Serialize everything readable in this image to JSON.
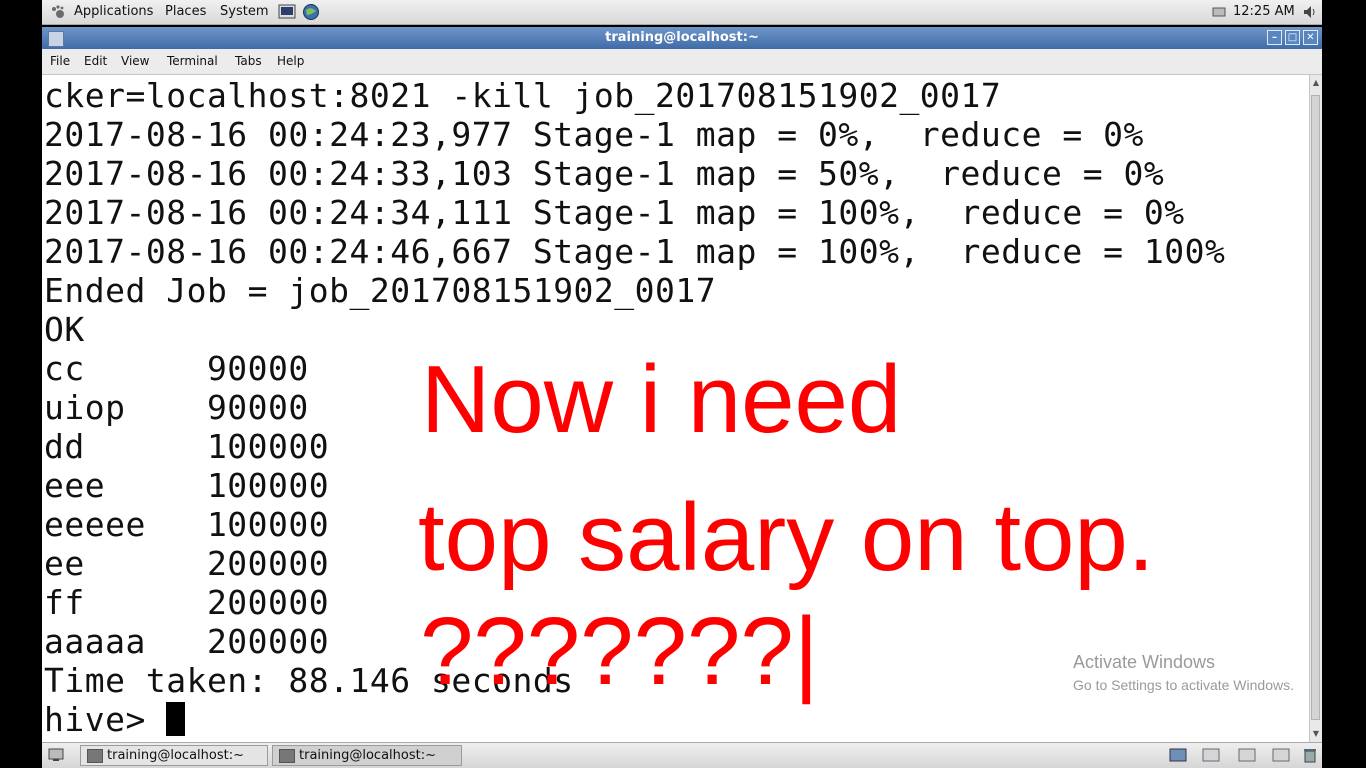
{
  "panel": {
    "menus": [
      "Applications",
      "Places",
      "System"
    ],
    "clock": "12:25 AM"
  },
  "window": {
    "title": "training@localhost:~",
    "menu": [
      "File",
      "Edit",
      "View",
      "Terminal",
      "Tabs",
      "Help"
    ]
  },
  "terminal": {
    "lines": [
      "cker=localhost:8021 -kill job_201708151902_0017",
      "2017-08-16 00:24:23,977 Stage-1 map = 0%,  reduce = 0%",
      "2017-08-16 00:24:33,103 Stage-1 map = 50%,  reduce = 0%",
      "2017-08-16 00:24:34,111 Stage-1 map = 100%,  reduce = 0%",
      "2017-08-16 00:24:46,667 Stage-1 map = 100%,  reduce = 100%",
      "Ended Job = job_201708151902_0017",
      "OK",
      "cc      90000",
      "uiop    90000",
      "dd      100000",
      "eee     100000",
      "eeeee   100000",
      "ee      200000",
      "ff      200000",
      "aaaaa   200000",
      "Time taken: 88.146 seconds"
    ],
    "prompt": "hive> "
  },
  "overlay": {
    "line1": "Now i need",
    "line2": "top salary on top.",
    "line3": "???????|"
  },
  "watermark": {
    "title": "Activate Windows",
    "subtitle": "Go to Settings to activate Windows."
  },
  "taskbar": {
    "tasks": [
      "training@localhost:~",
      "training@localhost:~"
    ]
  },
  "colors": {
    "titlebar": "#4f7ab3",
    "overlay_text": "#ff0000"
  }
}
